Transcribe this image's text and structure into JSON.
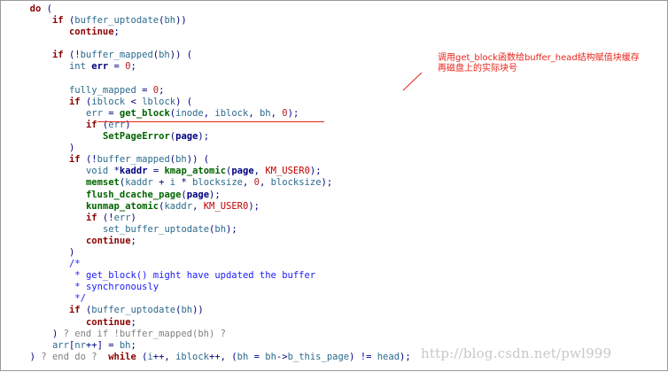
{
  "code": [
    {
      "indent": 2,
      "tokens": [
        [
          "kw",
          "do"
        ],
        [
          "op",
          " ("
        ]
      ]
    },
    {
      "indent": 6,
      "tokens": [
        [
          "kw",
          "if"
        ],
        [
          "op",
          " ("
        ],
        [
          "id",
          "buffer_uptodate"
        ],
        [
          "op",
          "("
        ],
        [
          "id",
          "bh"
        ],
        [
          "op",
          "))"
        ]
      ]
    },
    {
      "indent": 9,
      "tokens": [
        [
          "kw",
          "continue"
        ],
        [
          "op",
          ";"
        ]
      ]
    },
    {
      "indent": 0,
      "tokens": []
    },
    {
      "indent": 6,
      "tokens": [
        [
          "kw",
          "if"
        ],
        [
          "op",
          " (!"
        ],
        [
          "id",
          "buffer_mapped"
        ],
        [
          "op",
          "("
        ],
        [
          "id",
          "bh"
        ],
        [
          "op",
          ")) ("
        ]
      ]
    },
    {
      "indent": 9,
      "tokens": [
        [
          "id",
          "int"
        ],
        [
          "op",
          " "
        ],
        [
          "var",
          "err"
        ],
        [
          "op",
          " = "
        ],
        [
          "num",
          "0"
        ],
        [
          "op",
          ";"
        ]
      ]
    },
    {
      "indent": 0,
      "tokens": []
    },
    {
      "indent": 9,
      "tokens": [
        [
          "id",
          "fully_mapped"
        ],
        [
          "op",
          " = "
        ],
        [
          "num",
          "0"
        ],
        [
          "op",
          ";"
        ]
      ]
    },
    {
      "indent": 9,
      "tokens": [
        [
          "kw",
          "if"
        ],
        [
          "op",
          " ("
        ],
        [
          "id",
          "iblock"
        ],
        [
          "op",
          " < "
        ],
        [
          "id",
          "lblock"
        ],
        [
          "op",
          ") ("
        ]
      ]
    },
    {
      "indent": 12,
      "tokens": [
        [
          "id",
          "err"
        ],
        [
          "op",
          " = "
        ],
        [
          "fn",
          "get_block"
        ],
        [
          "op",
          "("
        ],
        [
          "id",
          "inode"
        ],
        [
          "op",
          ", "
        ],
        [
          "id",
          "iblock"
        ],
        [
          "op",
          ", "
        ],
        [
          "id",
          "bh"
        ],
        [
          "op",
          ", "
        ],
        [
          "num",
          "0"
        ],
        [
          "op",
          ");"
        ]
      ]
    },
    {
      "indent": 12,
      "tokens": [
        [
          "kw",
          "if"
        ],
        [
          "op",
          " ("
        ],
        [
          "id",
          "err"
        ],
        [
          "op",
          ")"
        ]
      ]
    },
    {
      "indent": 15,
      "tokens": [
        [
          "fn",
          "SetPageError"
        ],
        [
          "op",
          "("
        ],
        [
          "var",
          "page"
        ],
        [
          "op",
          ");"
        ]
      ]
    },
    {
      "indent": 9,
      "tokens": [
        [
          "op",
          ")"
        ]
      ]
    },
    {
      "indent": 9,
      "tokens": [
        [
          "kw",
          "if"
        ],
        [
          "op",
          " (!"
        ],
        [
          "id",
          "buffer_mapped"
        ],
        [
          "op",
          "("
        ],
        [
          "id",
          "bh"
        ],
        [
          "op",
          ")) ("
        ]
      ]
    },
    {
      "indent": 12,
      "tokens": [
        [
          "id",
          "void"
        ],
        [
          "op",
          " *"
        ],
        [
          "var",
          "kaddr"
        ],
        [
          "op",
          " = "
        ],
        [
          "fn",
          "kmap_atomic"
        ],
        [
          "op",
          "("
        ],
        [
          "var",
          "page"
        ],
        [
          "op",
          ", "
        ],
        [
          "mac",
          "KM_USER0"
        ],
        [
          "op",
          ");"
        ]
      ]
    },
    {
      "indent": 12,
      "tokens": [
        [
          "fn",
          "memset"
        ],
        [
          "op",
          "("
        ],
        [
          "id",
          "kaddr"
        ],
        [
          "op",
          " + "
        ],
        [
          "id",
          "i"
        ],
        [
          "op",
          " * "
        ],
        [
          "id",
          "blocksize"
        ],
        [
          "op",
          ", "
        ],
        [
          "num",
          "0"
        ],
        [
          "op",
          ", "
        ],
        [
          "id",
          "blocksize"
        ],
        [
          "op",
          ");"
        ]
      ]
    },
    {
      "indent": 12,
      "tokens": [
        [
          "fn",
          "flush_dcache_page"
        ],
        [
          "op",
          "("
        ],
        [
          "var",
          "page"
        ],
        [
          "op",
          ");"
        ]
      ]
    },
    {
      "indent": 12,
      "tokens": [
        [
          "fn",
          "kunmap_atomic"
        ],
        [
          "op",
          "("
        ],
        [
          "id",
          "kaddr"
        ],
        [
          "op",
          ", "
        ],
        [
          "mac",
          "KM_USER0"
        ],
        [
          "op",
          ");"
        ]
      ]
    },
    {
      "indent": 12,
      "tokens": [
        [
          "kw",
          "if"
        ],
        [
          "op",
          " (!"
        ],
        [
          "id",
          "err"
        ],
        [
          "op",
          ")"
        ]
      ]
    },
    {
      "indent": 15,
      "tokens": [
        [
          "id",
          "set_buffer_uptodate"
        ],
        [
          "op",
          "("
        ],
        [
          "id",
          "bh"
        ],
        [
          "op",
          ");"
        ]
      ]
    },
    {
      "indent": 12,
      "tokens": [
        [
          "kw",
          "continue"
        ],
        [
          "op",
          ";"
        ]
      ]
    },
    {
      "indent": 9,
      "tokens": [
        [
          "op",
          ")"
        ]
      ]
    },
    {
      "indent": 9,
      "tokens": [
        [
          "cm",
          "/*"
        ]
      ]
    },
    {
      "indent": 10,
      "tokens": [
        [
          "cm",
          "* get_block() might have updated the buffer"
        ]
      ]
    },
    {
      "indent": 10,
      "tokens": [
        [
          "cm",
          "* synchronously"
        ]
      ]
    },
    {
      "indent": 10,
      "tokens": [
        [
          "cm",
          "*/"
        ]
      ]
    },
    {
      "indent": 9,
      "tokens": [
        [
          "kw",
          "if"
        ],
        [
          "op",
          " ("
        ],
        [
          "id",
          "buffer_uptodate"
        ],
        [
          "op",
          "("
        ],
        [
          "id",
          "bh"
        ],
        [
          "op",
          "))"
        ]
      ]
    },
    {
      "indent": 12,
      "tokens": [
        [
          "kw",
          "continue"
        ],
        [
          "op",
          ";"
        ]
      ]
    },
    {
      "indent": 6,
      "tokens": [
        [
          "op",
          ") "
        ],
        [
          "gr",
          "? end if !buffer_mapped(bh) ?"
        ]
      ]
    },
    {
      "indent": 6,
      "tokens": [
        [
          "id",
          "arr"
        ],
        [
          "op",
          "["
        ],
        [
          "id",
          "nr"
        ],
        [
          "op",
          "++] = "
        ],
        [
          "id",
          "bh"
        ],
        [
          "op",
          ";"
        ]
      ]
    },
    {
      "indent": 2,
      "tokens": [
        [
          "op",
          ") "
        ],
        [
          "gr",
          "? end do ?"
        ],
        [
          "op",
          "  "
        ],
        [
          "kw",
          "while"
        ],
        [
          "op",
          " ("
        ],
        [
          "id",
          "i"
        ],
        [
          "op",
          "++, "
        ],
        [
          "id",
          "iblock"
        ],
        [
          "op",
          "++, ("
        ],
        [
          "id",
          "bh"
        ],
        [
          "op",
          " = "
        ],
        [
          "id",
          "bh"
        ],
        [
          "op",
          "->"
        ],
        [
          "id",
          "b_this_page"
        ],
        [
          "op",
          ") != "
        ],
        [
          "id",
          "head"
        ],
        [
          "op",
          ");"
        ]
      ]
    }
  ],
  "annotation": {
    "line1": "调用get_block函数给buffer_head结构赋值块缓存",
    "line2": "再磁盘上的实际块号"
  },
  "watermark": "http://blog.csdn.net/pwl999",
  "colors": {
    "annotation": "#e8241c",
    "keyword": "#8b0000",
    "function": "#006400",
    "identifier": "#2b6a8c",
    "comment": "#1a1aff",
    "macro": "#c00000",
    "watermark": "#c8c8c8"
  }
}
